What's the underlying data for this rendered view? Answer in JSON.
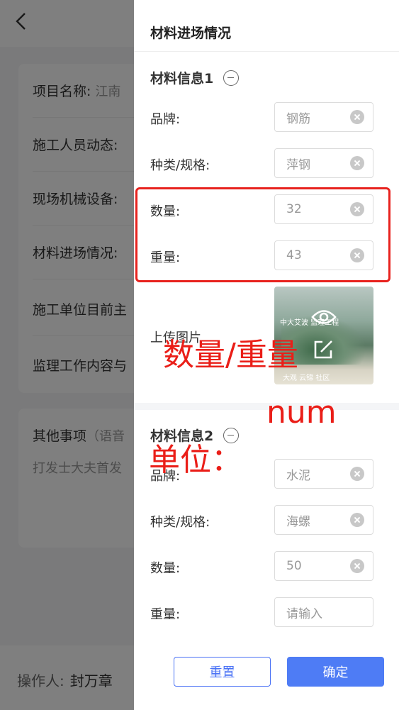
{
  "background": {
    "rows": [
      {
        "label": "项目名称:",
        "value": "江南"
      },
      {
        "label": "施工人员动态:",
        "value": ""
      },
      {
        "label": "现场机械设备:",
        "value": ""
      },
      {
        "label": "材料进场情况:",
        "value": ""
      },
      {
        "label": "施工单位目前主",
        "value": ""
      },
      {
        "label": "监理工作内容与",
        "value": ""
      }
    ],
    "other_title": "其他事项",
    "other_hint": "（语音",
    "other_text": "打发士大夫首发",
    "operator_label": "操作人:",
    "operator_name": "封万章"
  },
  "drawer": {
    "title": "材料进场情况",
    "section1": {
      "title": "材料信息1",
      "fields": [
        {
          "label": "品牌:",
          "value": "钢筋"
        },
        {
          "label": "种类/规格:",
          "value": "萍钢"
        },
        {
          "label": "数量:",
          "value": "32"
        },
        {
          "label": "重量:",
          "value": "43"
        }
      ],
      "upload_label": "上传图片",
      "thumb_text_top": "中大艾波 监理工程",
      "thumb_text_bottom": "大观 云锦 社区"
    },
    "section2": {
      "title": "材料信息2",
      "fields": [
        {
          "label": "品牌:",
          "value": "水泥"
        },
        {
          "label": "种类/规格:",
          "value": "海螺"
        },
        {
          "label": "数量:",
          "value": "50"
        },
        {
          "label": "重量:",
          "value": "",
          "placeholder": "请输入"
        }
      ]
    },
    "buttons": {
      "reset": "重置",
      "confirm": "确定"
    }
  },
  "annotations": {
    "line1": "数量/重量",
    "line2": "num",
    "line3": "单位："
  },
  "colors": {
    "primary": "#4e7cf5",
    "annotation": "#ea1e18"
  }
}
